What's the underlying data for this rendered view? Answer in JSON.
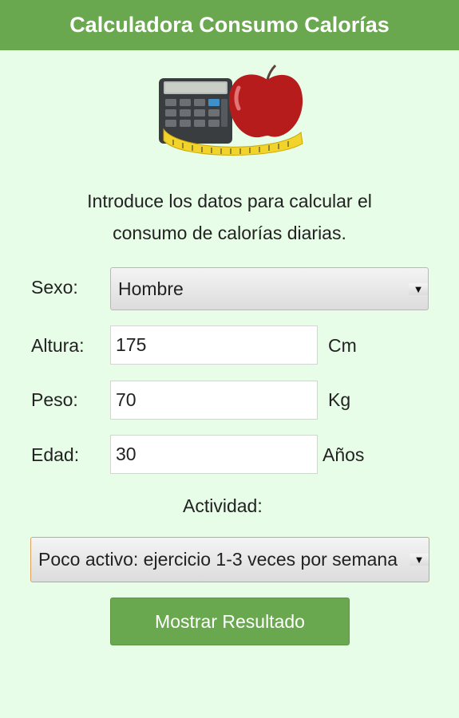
{
  "header": {
    "title": "Calculadora Consumo Calorías"
  },
  "intro": {
    "line1": "Introduce los datos para calcular el",
    "line2": "consumo de calorías diarias."
  },
  "form": {
    "sexo": {
      "label": "Sexo:",
      "value": "Hombre"
    },
    "altura": {
      "label": "Altura:",
      "value": "175",
      "unit": "Cm"
    },
    "peso": {
      "label": "Peso:",
      "value": "70",
      "unit": "Kg"
    },
    "edad": {
      "label": "Edad:",
      "value": "30",
      "unit": "Años"
    },
    "actividad": {
      "label": "Actividad:",
      "value": "Poco activo: ejercicio 1-3 veces por semana"
    }
  },
  "submit": {
    "label": "Mostrar Resultado"
  },
  "icons": {
    "dropdown": "caret-down-icon",
    "hero": "calculator-apple-tape-illustration"
  },
  "colors": {
    "accent": "#6aa84f",
    "background": "#e8fde8",
    "focus_border": "#e0a060"
  }
}
